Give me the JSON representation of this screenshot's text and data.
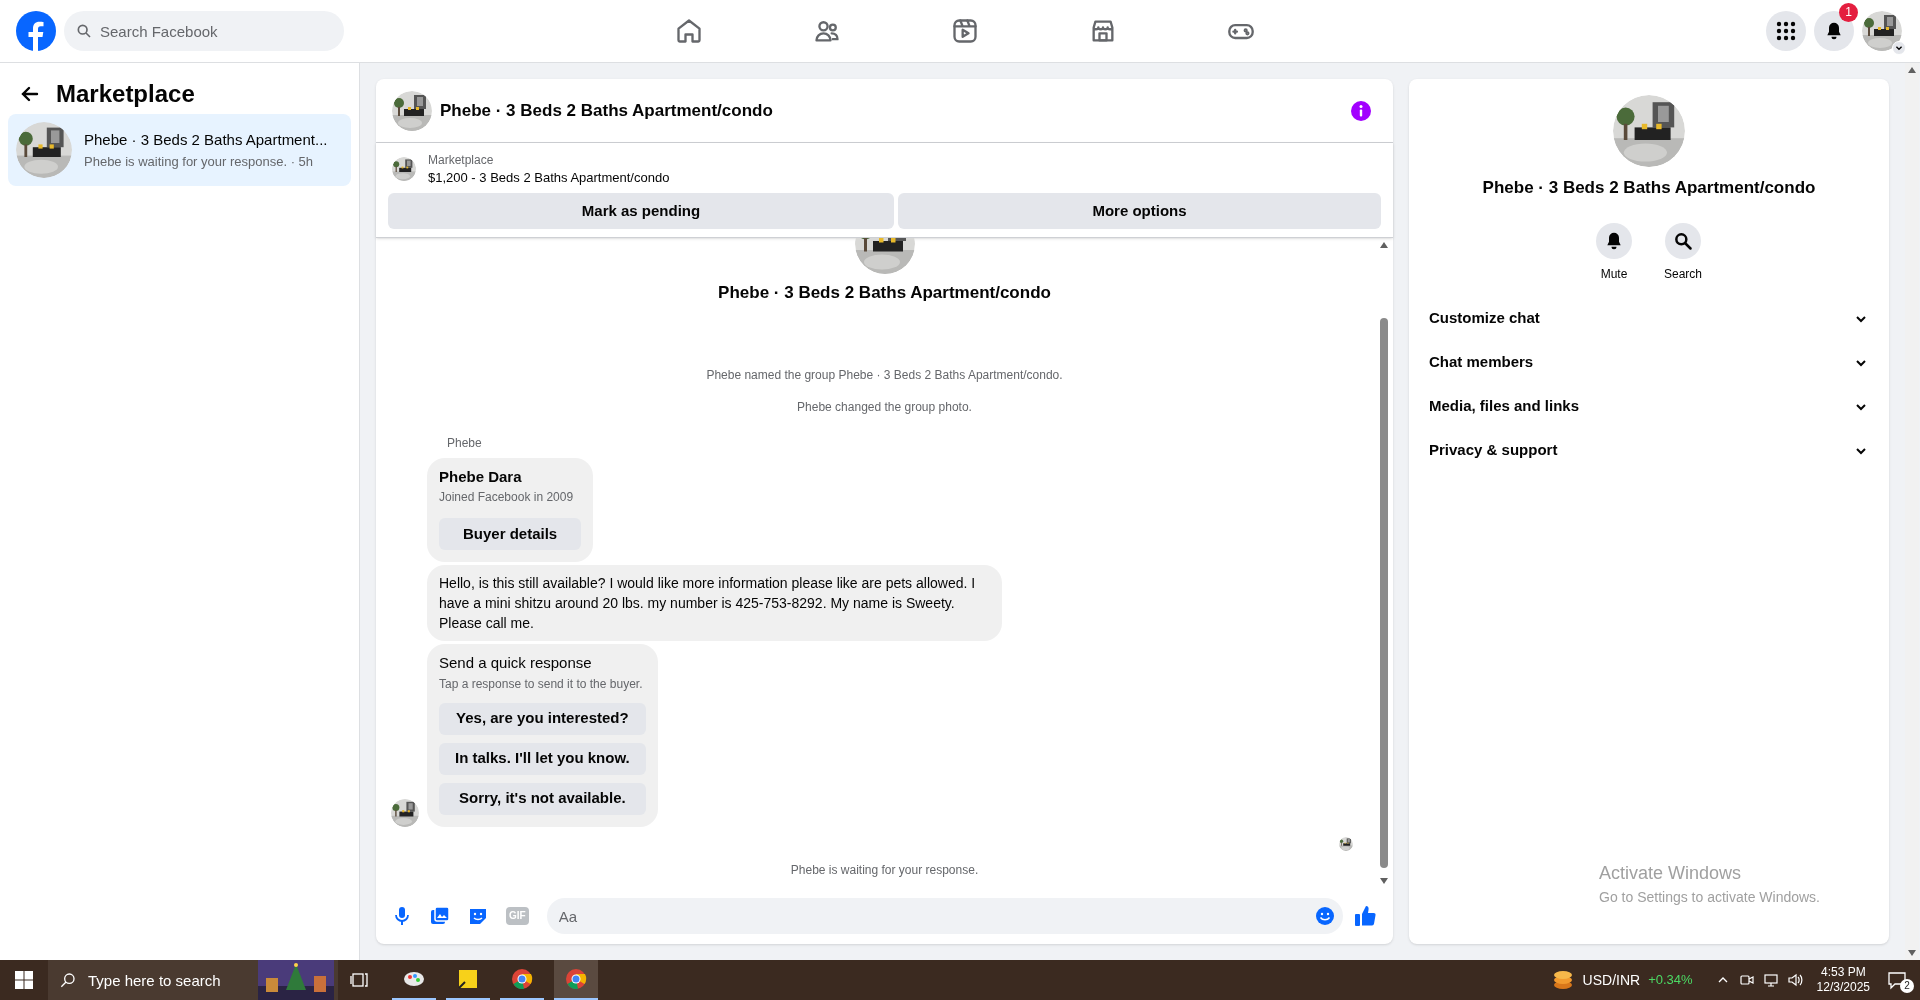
{
  "top_bar": {
    "search_placeholder": "Search Facebook",
    "nav": [
      {
        "kind": "home"
      },
      {
        "kind": "friends"
      },
      {
        "kind": "video"
      },
      {
        "kind": "marketplace"
      },
      {
        "kind": "gaming"
      }
    ],
    "notification_count": "1"
  },
  "sidebar": {
    "title": "Marketplace",
    "conversations": [
      {
        "title": "Phebe · 3 Beds 2 Baths Apartment...",
        "subtitle": "Phebe is waiting for your response. · 5h",
        "selected": true
      }
    ]
  },
  "chat": {
    "title": "Phebe · 3 Beds 2 Baths Apartment/condo",
    "listing": {
      "source": "Marketplace",
      "summary": "$1,200 - 3 Beds 2 Baths Apartment/condo"
    },
    "actions": [
      "Mark as pending",
      "More options"
    ],
    "group_name": "Phebe · 3 Beds 2 Baths Apartment/condo",
    "events": [
      "Phebe named the group Phebe · 3 Beds 2 Baths Apartment/condo.",
      "Phebe changed the group photo."
    ],
    "sender": "Phebe",
    "buyer_card": {
      "name": "Phebe Dara",
      "meta": "Joined Facebook in 2009",
      "button": "Buyer details"
    },
    "message": "Hello, is this still available? I would like more information please like are pets allowed. I have a mini shitzu around 20 lbs. my number is 425-753-8292. My name is Sweety. Please call me.",
    "quick_response": {
      "title": "Send a quick response",
      "hint": "Tap a response to send it to the buyer.",
      "options": [
        "Yes, are you interested?",
        "In talks. I'll let you know.",
        "Sorry, it's not available."
      ]
    },
    "status": "Phebe is waiting for your response.",
    "composer": {
      "gif_label": "GIF",
      "placeholder": "Aa"
    }
  },
  "details": {
    "title": "Phebe · 3 Beds 2 Baths Apartment/condo",
    "actions": [
      {
        "kind": "mute",
        "label": "Mute"
      },
      {
        "kind": "search",
        "label": "Search"
      }
    ],
    "sections": [
      {
        "label": "Customize chat",
        "expanded": false
      },
      {
        "label": "Chat members",
        "expanded": false
      },
      {
        "label": "Media, files and links",
        "expanded": false
      },
      {
        "label": "Privacy & support",
        "expanded": false
      }
    ]
  },
  "activation_notice": {
    "title": "Activate Windows",
    "hint": "Go to Settings to activate Windows."
  },
  "taskbar": {
    "search_placeholder": "Type here to search",
    "ticker": "USD/INR",
    "change": "+0.34%",
    "time": "4:53 PM",
    "date": "12/3/2025",
    "notification_count": "2"
  }
}
